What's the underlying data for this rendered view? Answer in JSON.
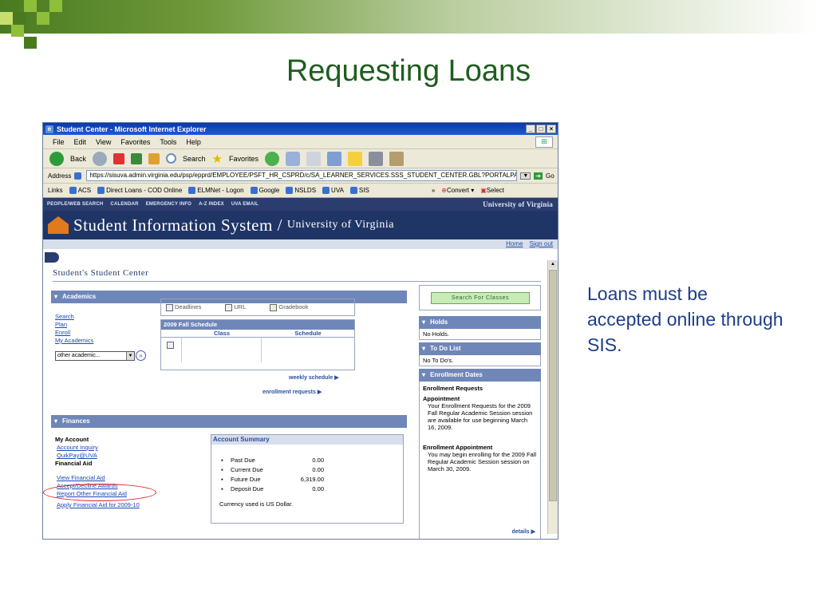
{
  "slide": {
    "title": "Requesting Loans",
    "note": "Loans must be accepted online through SIS."
  },
  "browser": {
    "title": "Student Center - Microsoft Internet Explorer",
    "menu": [
      "File",
      "Edit",
      "View",
      "Favorites",
      "Tools",
      "Help"
    ],
    "toolbar": {
      "back": "Back",
      "search": "Search",
      "favorites": "Favorites"
    },
    "address_label": "Address",
    "url": "https://sisuva.admin.virginia.edu/psp/epprd/EMPLOYEE/PSFT_HR_CSPRD/c/SA_LEARNER_SERVICES.SSS_STUDENT_CENTER.GBL?PORTALPAR",
    "go_label": "Go",
    "links_label": "Links",
    "links": [
      "ACS",
      "Direct Loans - COD Online",
      "ELMNet - Logon",
      "Google",
      "NSLDS",
      "UVA",
      "SIS"
    ],
    "convert_label": "Convert",
    "select_label": "Select"
  },
  "sis": {
    "nav": [
      "PEOPLE/WEB SEARCH",
      "CALENDAR",
      "EMERGENCY INFO",
      "A-Z INDEX",
      "UVA EMAIL"
    ],
    "univ": "University of Virginia",
    "banner": "Student Information System /",
    "banner_univ": "University of Virginia",
    "home": "Home",
    "signout": "Sign out",
    "page_title": "Student's Student Center",
    "academics": {
      "header": "Academics",
      "links": [
        "Search",
        "Plan",
        "Enroll",
        "My Academics"
      ],
      "select_value": "other academic...",
      "tabs": [
        "Deadlines",
        "URL",
        "Gradebook"
      ],
      "schedule_title": "2009 Fall Schedule",
      "schedule_cols": [
        "Class",
        "Schedule"
      ],
      "weekly": "weekly schedule ▶",
      "enrollment_requests": "enrollment requests   ▶"
    },
    "finances": {
      "header": "Finances",
      "my_account": "My Account",
      "account_links": [
        "Account Inquiry",
        "QuikPay@UVA"
      ],
      "financial_aid": "Financial Aid",
      "aid_links": [
        "View Financial Aid",
        "Accept/Decline Awards",
        "Report Other Financial Aid"
      ],
      "apply": "Apply Financial Aid for 2009-10",
      "summary_title": "Account Summary",
      "summary_rows": [
        {
          "label": "Past Due",
          "value": "0.00"
        },
        {
          "label": "Current Due",
          "value": "0.00"
        },
        {
          "label": "Future Due",
          "value": "6,319.00"
        },
        {
          "label": "Deposit Due",
          "value": "0.00"
        }
      ],
      "currency": "Currency used is US Dollar."
    },
    "search_classes": "Search For Classes",
    "holds": {
      "header": "Holds",
      "body": "No Holds."
    },
    "todo": {
      "header": "To Do List",
      "body": "No To Do's."
    },
    "enrollment_dates": {
      "header": "Enrollment Dates",
      "requests_title": "Enrollment Requests",
      "appointment_title": "Appointment",
      "appointment_text": "Your Enrollment Requests for the 2009 Fall Regular Academic Session session are available for use beginning March 16, 2009.",
      "enroll_appt_title": "Enrollment Appointment",
      "enroll_appt_text": "You may begin enrolling for the 2009 Fall Regular Academic Session session on March 30, 2009.",
      "details": "details ▶"
    }
  }
}
